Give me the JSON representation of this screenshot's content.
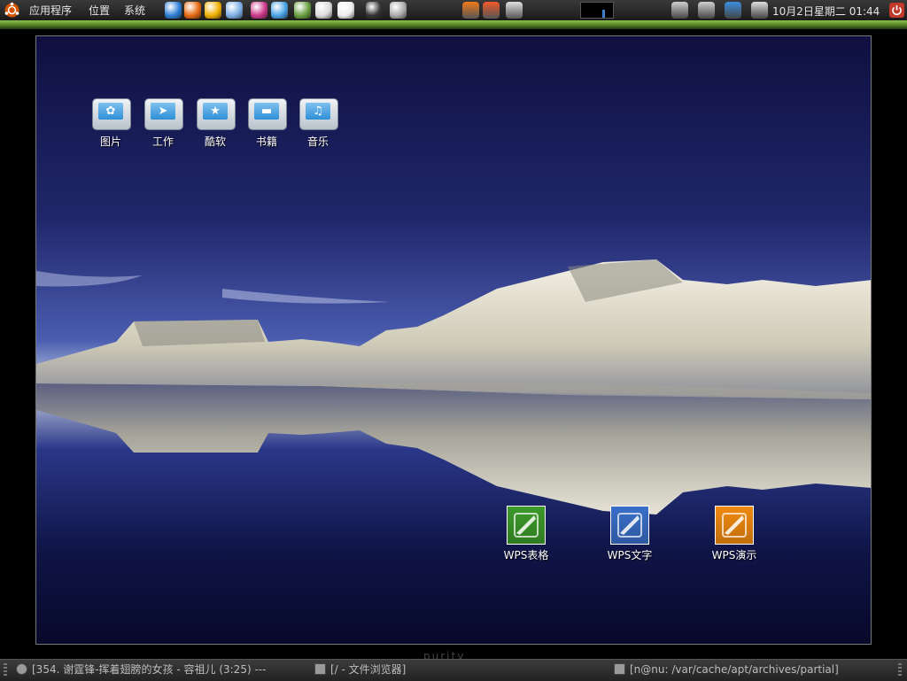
{
  "top_panel": {
    "menu": [
      "应用程序",
      "位置",
      "系统"
    ],
    "launchers": [
      {
        "name": "evolution-icon",
        "color": "#2f7fd6"
      },
      {
        "name": "firefox-icon",
        "color": "#e86a12"
      },
      {
        "name": "qq-penguin-icon",
        "color": "#f0b000"
      },
      {
        "name": "package-cube-icon",
        "color": "#7fb0e6"
      },
      {
        "name": "picasa-icon",
        "color": "#cc3a8a"
      },
      {
        "name": "messenger-icon",
        "color": "#4aa3e6"
      },
      {
        "name": "book-icon",
        "color": "#6aa040"
      },
      {
        "name": "skype-icon",
        "color": "#dcdcdc"
      },
      {
        "name": "audio-player-icon",
        "color": "#eeeeee"
      },
      {
        "name": "terminal-icon",
        "color": "#333333"
      },
      {
        "name": "screenshot-camera-icon",
        "color": "#aaaaaa"
      }
    ],
    "center_launchers": [
      {
        "name": "rss-reader-icon",
        "color": "#f07a1a"
      },
      {
        "name": "file-manager-icon",
        "color": "#f05a2a"
      },
      {
        "name": "screen-capture-icon",
        "color": "#e0e0e0"
      }
    ],
    "tray": [
      {
        "name": "keyboard-icon",
        "color": "#cfcfcf"
      },
      {
        "name": "window-switch-icon",
        "color": "#cfcfcf"
      },
      {
        "name": "notification-icon",
        "color": "#3b8ee0"
      },
      {
        "name": "volume-icon",
        "color": "#dddddd"
      }
    ],
    "clock": "10月2日星期二 01:44"
  },
  "desktop": {
    "folders": [
      {
        "label": "图片",
        "glyph": "✿"
      },
      {
        "label": "工作",
        "glyph": "➤"
      },
      {
        "label": "酷软",
        "glyph": "★"
      },
      {
        "label": "书籍",
        "glyph": "▬"
      },
      {
        "label": "音乐",
        "glyph": "♫"
      }
    ],
    "wps": [
      {
        "label": "WPS表格",
        "color": "#3c9a2a"
      },
      {
        "label": "WPS文字",
        "color": "#3a6fc8"
      },
      {
        "label": "WPS演示",
        "color": "#f08a10"
      }
    ],
    "watermark": "purity"
  },
  "bottom_panel": {
    "tasks": [
      "[354. 谢霆锋-挥着翅膀的女孩 - 容祖儿 (3:25) ---",
      "[/ - 文件浏览器]",
      "[n@nu: /var/cache/apt/archives/partial]"
    ]
  }
}
